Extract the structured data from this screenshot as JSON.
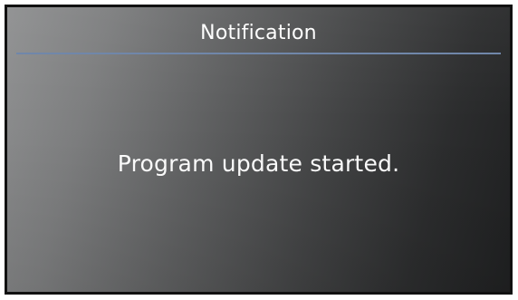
{
  "dialog": {
    "title": "Notification",
    "message": "Program update started."
  },
  "colors": {
    "title_rule": "#6d84a8",
    "text": "#ffffff",
    "frame": "#111111"
  }
}
